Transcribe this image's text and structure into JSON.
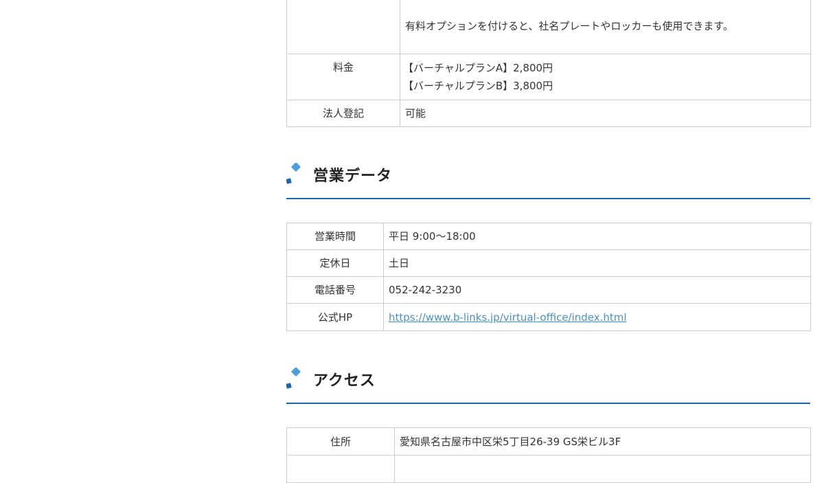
{
  "plan_table": {
    "rows": [
      {
        "label": "",
        "lines": [
          "有料オプションを付けると、社名プレートやロッカーも使用できます。"
        ]
      },
      {
        "label": "料金",
        "lines": [
          "【バーチャルプランA】2,800円",
          "【バーチャルプランB】3,800円"
        ]
      },
      {
        "label": "法人登記",
        "lines": [
          "可能"
        ]
      }
    ]
  },
  "business_section": {
    "heading": "営業データ",
    "rows": [
      {
        "label": "営業時間",
        "value": "平日 9:00～18:00"
      },
      {
        "label": "定休日",
        "value": "土日"
      },
      {
        "label": "電話番号",
        "value": "052-242-3230"
      },
      {
        "label": "公式HP",
        "value": "https://www.b-links.jp/virtual-office/index.html"
      }
    ]
  },
  "access_section": {
    "heading": "アクセス",
    "rows": [
      {
        "label": "住所",
        "value": "愛知県名古屋市中区栄5丁目26-39 GS栄ビル3F"
      },
      {
        "label": "",
        "value": ""
      }
    ]
  },
  "colors": {
    "accent_blue": "#1a66a8",
    "accent_light_blue": "#4a9fd8",
    "link": "#4a90c8",
    "border": "#cccccc"
  },
  "icons": {
    "heading_mark": "diamond-square-mark-icon"
  }
}
